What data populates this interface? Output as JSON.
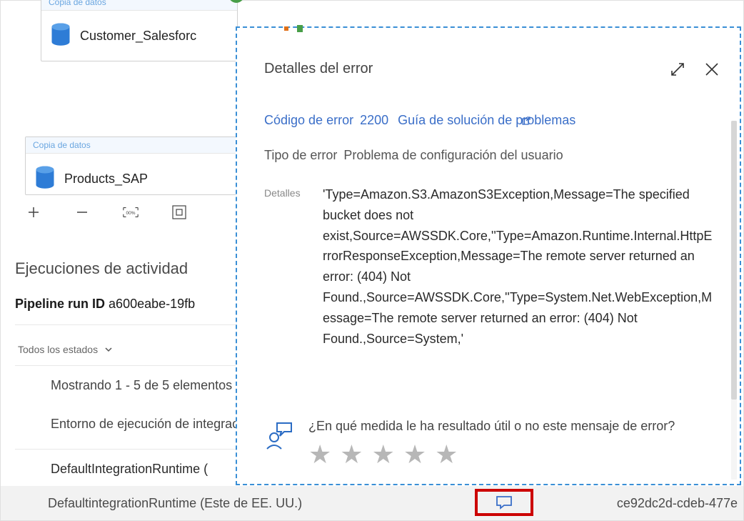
{
  "activities": {
    "top": {
      "header": "Copia de datos",
      "name": "Customer_Salesforc"
    },
    "bottom": {
      "header": "Copia de datos",
      "name": "Products_SAP"
    }
  },
  "section": {
    "title": "Ejecuciones de actividad",
    "run_label": "Pipeline run ID",
    "run_id": "a600eabe-19fb",
    "status_filter": "Todos los estados",
    "showing": "Mostrando 1 - 5 de 5 elementos",
    "env_label": "Entorno de ejecución de integración",
    "runtime1": "DefaultIntegrationRuntime (",
    "runtime2": "DefaultintegrationRuntime (Este de EE. UU.)",
    "row_id": "ce92dc2d-cdeb-477e"
  },
  "panel": {
    "title": "Detalles del error",
    "code_prefix": "Código de error",
    "code": "2200",
    "guide": "Guía de solución de problemas",
    "type_prefix": "Tipo de error",
    "type_value": "Problema de configuración del usuario",
    "details_label": "Detalles",
    "details_text": "'Type=Amazon.S3.AmazonS3Exception,Message=The specified bucket does not exist,Source=AWSSDK.Core,''Type=Amazon.Runtime.Internal.HttpErrorResponseException,Message=The remote server returned an error: (404) Not Found.,Source=AWSSDK.Core,''Type=System.Net.WebException,Message=The remote server returned an error: (404) Not Found.,Source=System,'",
    "feedback_prompt": "¿En qué medida le ha resultado útil o no este mensaje de error?"
  }
}
